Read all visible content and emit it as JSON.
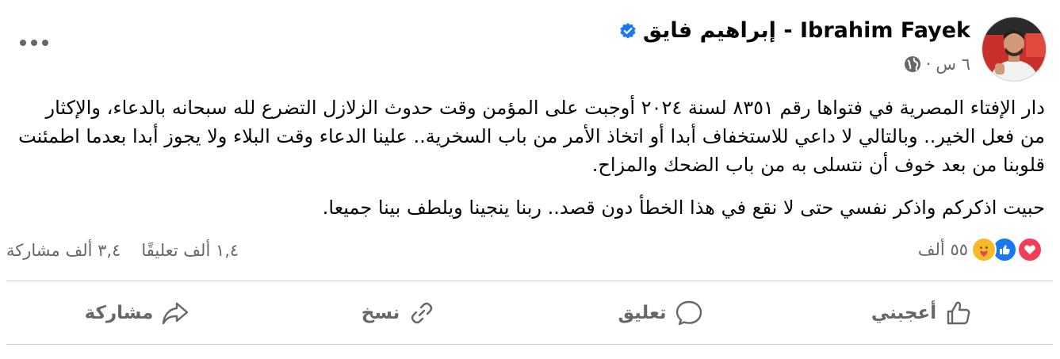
{
  "post": {
    "author": "Ibrahim Fayek - إبراهيم فايق",
    "time": "٦ س",
    "separator": "·",
    "paragraphs": [
      "دار الإفتاء المصرية في فتواها رقم ٨٣٥١ لسنة ٢٠٢٤ أوجبت على المؤمن وقت حدوث الزلازل التضرع لله سبحانه بالدعاء، والإكثار من فعل الخير.. وبالتالي لا داعي للاستخفاف أبدا أو اتخاذ الأمر من باب السخرية.. علينا الدعاء وقت البلاء ولا يجوز أبدا بعدما اطمئنت قلوبنا من بعد خوف أن نتسلى به من باب الضحك والمزاح.",
      "حبيت اذكركم واذكر نفسي حتى لا نقع في هذا الخطأ دون قصد.. ربنا ينجينا ويلطف بينا جميعا."
    ],
    "reactions_count": "٥٥ ألف",
    "comments_count": "١,٤ ألف تعليقًا",
    "shares_count": "٣,٤ ألف مشاركة",
    "icons": {
      "verified": "verified-badge-icon",
      "privacy": "globe-icon",
      "more": "more-options-icon",
      "reactions": [
        "love-reaction-icon",
        "like-reaction-icon",
        "care-reaction-icon"
      ]
    }
  },
  "actions": {
    "like": "أعجبني",
    "comment": "تعليق",
    "copy": "نسخ",
    "share": "مشاركة"
  },
  "colors": {
    "accent": "#1877f2",
    "secondary_text": "#65676b",
    "love": "#f33e58",
    "care": "#f7b928",
    "divider": "#ced0d4"
  }
}
